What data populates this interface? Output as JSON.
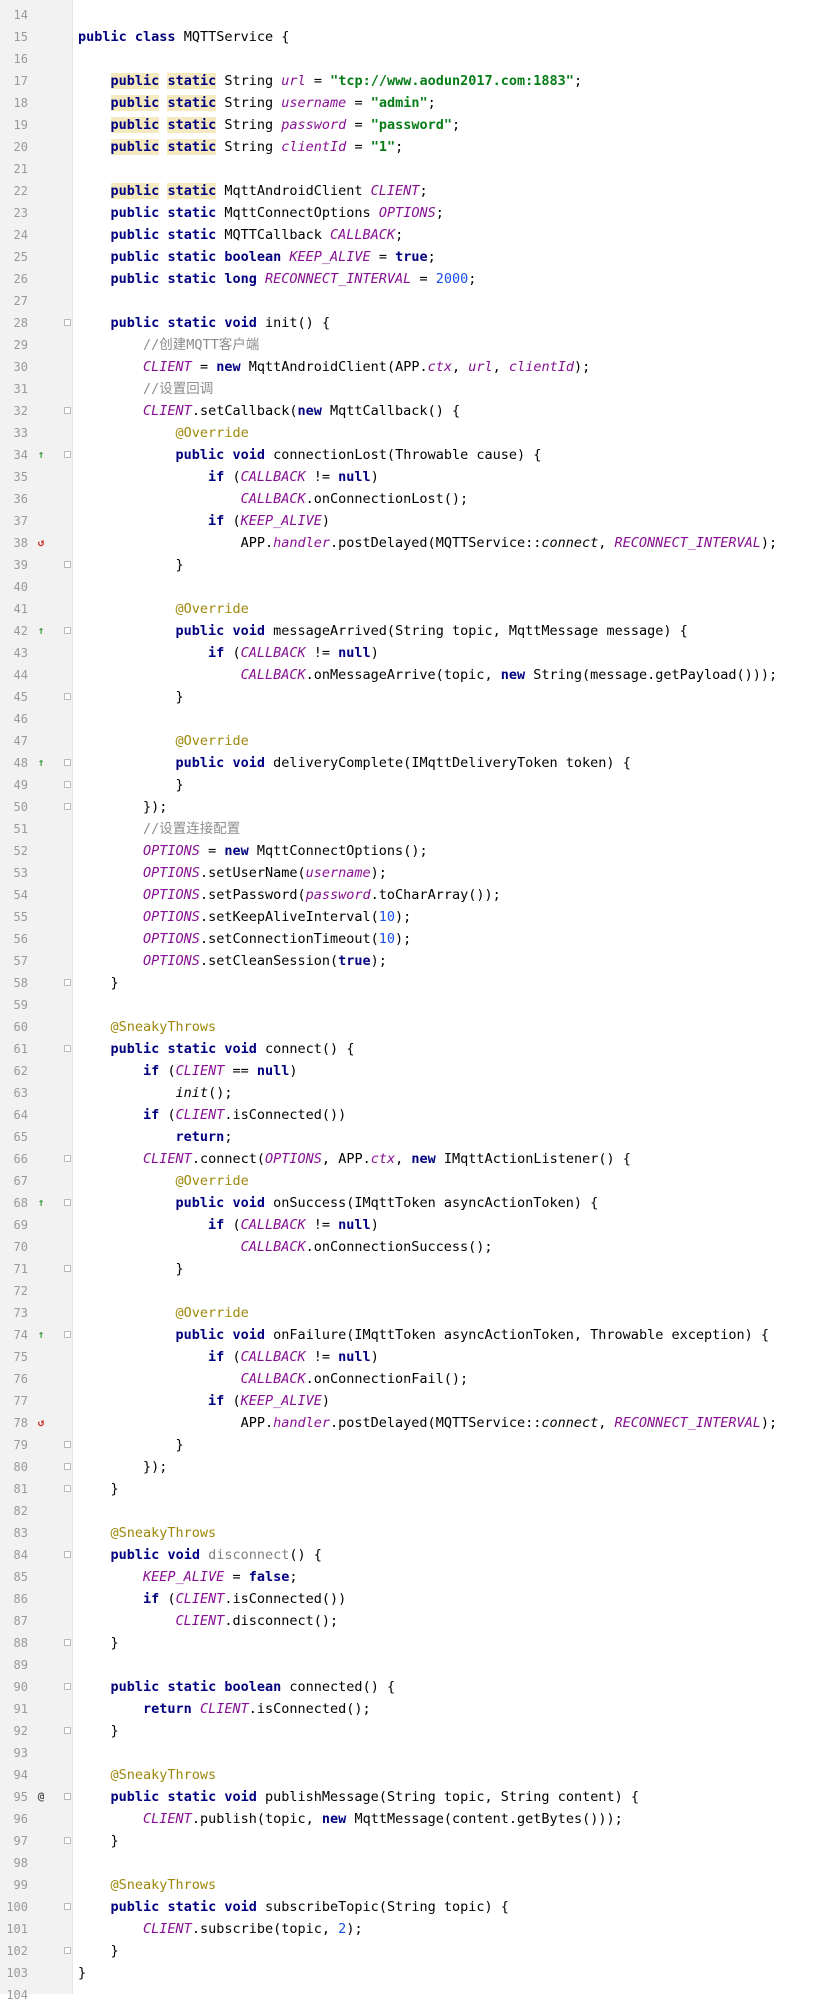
{
  "editor": {
    "line_numbers": [
      "14",
      "15",
      "16",
      "17",
      "18",
      "19",
      "20",
      "21",
      "22",
      "23",
      "24",
      "25",
      "26",
      "27",
      "28",
      "29",
      "30",
      "31",
      "32",
      "33",
      "34",
      "35",
      "36",
      "37",
      "38",
      "39",
      "40",
      "41",
      "42",
      "43",
      "44",
      "45",
      "46",
      "47",
      "48",
      "49",
      "50",
      "51",
      "52",
      "53",
      "54",
      "55",
      "56",
      "57",
      "58",
      "59",
      "60",
      "61",
      "62",
      "63",
      "64",
      "65",
      "66",
      "67",
      "68",
      "69",
      "70",
      "71",
      "72",
      "73",
      "74",
      "75",
      "76",
      "77",
      "78",
      "79",
      "80",
      "81",
      "82",
      "83",
      "84",
      "85",
      "86",
      "87",
      "88",
      "89",
      "90",
      "91",
      "92",
      "93",
      "94",
      "95",
      "96",
      "97",
      "98",
      "99",
      "100",
      "101",
      "102",
      "103",
      "104"
    ],
    "gutter_markers": {
      "override": "↑",
      "recursion": "↺",
      "at": "@"
    }
  },
  "code": {
    "l15_class": "public class MQTTService {",
    "url_decl": "public static String url = \"tcp://www.aodun2017.com:1883\";",
    "username_decl": "public static String username = \"admin\";",
    "password_decl": "public static String password = \"password\";",
    "clientid_decl": "public static String clientId = \"1\";",
    "client_decl": "public static MqttAndroidClient CLIENT;",
    "options_decl": "public static MqttConnectOptions OPTIONS;",
    "callback_decl": "public static MQTTCallback CALLBACK;",
    "keepalive_decl": "public static boolean KEEP_ALIVE = true;",
    "reconnect_decl": "public static long RECONNECT_INTERVAL = 2000;",
    "init_sig": "public static void init() {",
    "comment_create": "//创建MQTT客户端",
    "client_new": "CLIENT = new MqttAndroidClient(APP.ctx, url, clientId);",
    "comment_callback": "//设置回调",
    "setcallback": "CLIENT.setCallback(new MqttCallback() {",
    "override": "@Override",
    "connlost_sig": "public void connectionLost(Throwable cause) {",
    "if_callback": "if (CALLBACK != null)",
    "cb_connlost": "CALLBACK.onConnectionLost();",
    "if_keepalive": "if (KEEP_ALIVE)",
    "postdelayed": "APP.handler.postDelayed(MQTTService::connect, RECONNECT_INTERVAL);",
    "close_brace": "}",
    "msgarrived_sig": "public void messageArrived(String topic, MqttMessage message) {",
    "cb_msgarrive": "CALLBACK.onMessageArrive(topic, new String(message.getPayload()));",
    "delivery_sig": "public void deliveryComplete(IMqttDeliveryToken token) {",
    "close_anon": "});",
    "comment_options": "//设置连接配置",
    "options_new": "OPTIONS = new MqttConnectOptions();",
    "set_username": "OPTIONS.setUserName(username);",
    "set_password": "OPTIONS.setPassword(password.toCharArray());",
    "set_keepalive": "OPTIONS.setKeepAliveInterval(10);",
    "set_timeout": "OPTIONS.setConnectionTimeout(10);",
    "set_clean": "OPTIONS.setCleanSession(true);",
    "sneaky": "@SneakyThrows",
    "connect_sig": "public static void connect() {",
    "if_client_null": "if (CLIENT == null)",
    "init_call": "init();",
    "if_isconnected": "if (CLIENT.isConnected())",
    "return_stmt": "return;",
    "client_connect": "CLIENT.connect(OPTIONS, APP.ctx, new IMqttActionListener() {",
    "onsuccess_sig": "public void onSuccess(IMqttToken asyncActionToken) {",
    "cb_connsuccess": "CALLBACK.onConnectionSuccess();",
    "onfailure_sig": "public void onFailure(IMqttToken asyncActionToken, Throwable exception) {",
    "cb_connfail": "CALLBACK.onConnectionFail();",
    "disconnect_sig": "public void disconnect() {",
    "keepalive_false": "KEEP_ALIVE = false;",
    "client_disconnect": "CLIENT.disconnect();",
    "connected_sig": "public static boolean connected() {",
    "return_isconnected": "return CLIENT.isConnected();",
    "publish_sig": "public static void publishMessage(String topic, String content) {",
    "publish_call": "CLIENT.publish(topic, new MqttMessage(content.getBytes()));",
    "subscribe_sig": "public static void subscribeTopic(String topic) {",
    "subscribe_call": "CLIENT.subscribe(topic, 2);"
  }
}
